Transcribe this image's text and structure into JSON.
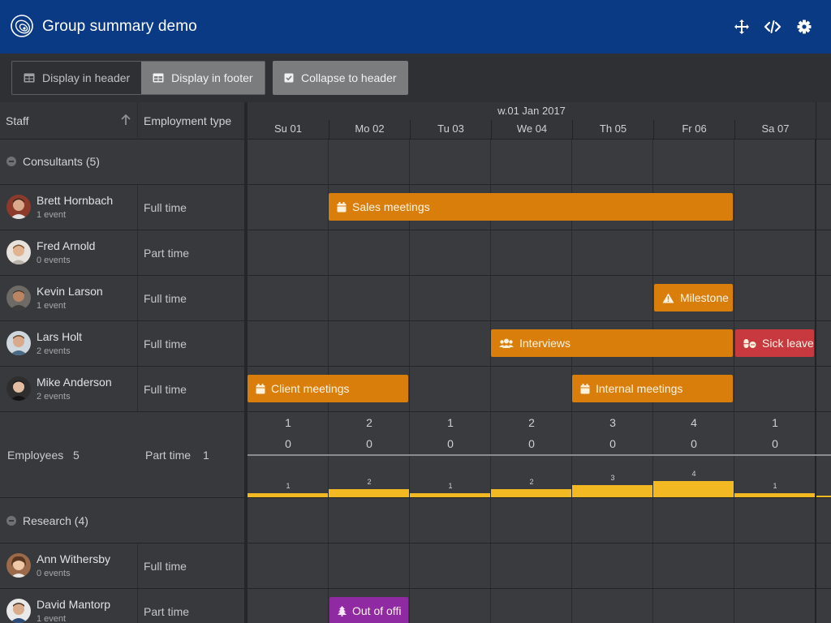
{
  "header": {
    "title": "Group summary demo",
    "icons": [
      "fullscreen-icon",
      "code-icon",
      "settings-icon"
    ]
  },
  "toolbar": {
    "display_in_header": "Display in header",
    "display_in_footer": "Display in footer",
    "collapse_to_header": "Collapse to header"
  },
  "columns": {
    "staff": "Staff",
    "employment_type": "Employment type"
  },
  "timeaxis": {
    "week": "w.01 Jan 2017",
    "days": [
      "Su 01",
      "Mo 02",
      "Tu 03",
      "We 04",
      "Th 05",
      "Fr 06",
      "Sa 07"
    ]
  },
  "groups": [
    {
      "label": "Consultants (5)",
      "rows": [
        {
          "name": "Brett Hornbach",
          "events": "1 event",
          "type": "Full time"
        },
        {
          "name": "Fred Arnold",
          "events": "0 events",
          "type": "Part time"
        },
        {
          "name": "Kevin Larson",
          "events": "1 event",
          "type": "Full time"
        },
        {
          "name": "Lars Holt",
          "events": "2 events",
          "type": "Full time"
        },
        {
          "name": "Mike Anderson",
          "events": "2 events",
          "type": "Full time"
        }
      ],
      "summary": {
        "employees_label": "Employees",
        "employees_value": "5",
        "parttime_label": "Part time",
        "parttime_value": "1",
        "fulltime_counts": [
          "1",
          "2",
          "1",
          "2",
          "3",
          "4",
          "1"
        ],
        "parttime_counts": [
          "0",
          "0",
          "0",
          "0",
          "0",
          "0",
          "0"
        ],
        "bar_values": [
          1,
          2,
          1,
          2,
          3,
          4,
          1
        ],
        "bar_labels": [
          "1",
          "2",
          "1",
          "2",
          "3",
          "4",
          "1"
        ]
      }
    },
    {
      "label": "Research (4)",
      "rows": [
        {
          "name": "Ann Withersby",
          "events": "0 events",
          "type": "Full time"
        },
        {
          "name": "David Mantorp",
          "events": "1 event",
          "type": "Part time"
        }
      ]
    }
  ],
  "events": [
    {
      "name": "Sales meetings",
      "icon": "calendar-icon",
      "color": "#d97d0b"
    },
    {
      "name": "Milestone",
      "icon": "warning-icon",
      "color": "#d97d0b"
    },
    {
      "name": "Interviews",
      "icon": "users-icon",
      "color": "#d97d0b"
    },
    {
      "name": "Sick leave",
      "icon": "pills-icon",
      "color": "#c7383f"
    },
    {
      "name": "Client meetings",
      "icon": "calendar-icon",
      "color": "#d97d0b"
    },
    {
      "name": "Internal meetings",
      "icon": "calendar-icon",
      "color": "#d97d0b"
    },
    {
      "name": "Out of offi",
      "icon": "tree-icon",
      "color": "#8f2aa3"
    }
  ],
  "colors": {
    "header_bg": "#0b3a85",
    "bar": "#f2b923",
    "event_orange": "#d97d0b",
    "event_red": "#c7383f",
    "event_purple": "#8f2aa3"
  }
}
